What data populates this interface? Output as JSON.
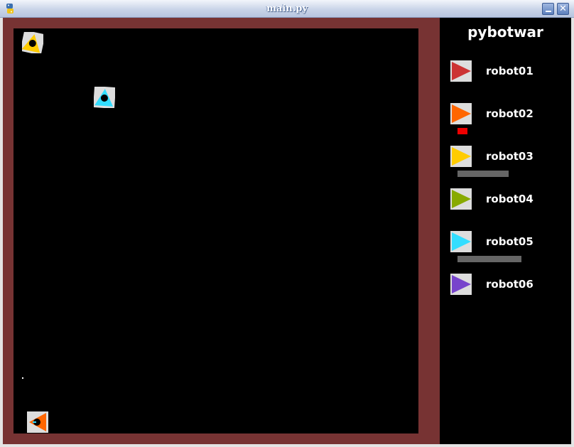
{
  "window": {
    "title": "main.py",
    "minimize_icon": "minimize-icon",
    "close_icon": "close-icon",
    "close_glyph": "✕",
    "app_icon": "python-icon"
  },
  "colors": {
    "arena_border": "#773333",
    "arena_background": "#000000",
    "badge_background": "#dddddd",
    "bar_gray": "#666666",
    "bar_red": "#ee0000"
  },
  "sidebar": {
    "title": "pybotwar",
    "robots": [
      {
        "label": "robot01",
        "color": "#cc3333",
        "health_bar": null
      },
      {
        "label": "robot02",
        "color": "#ff6600",
        "health_bar": {
          "fraction": 0.16,
          "color": "#ee0000"
        }
      },
      {
        "label": "robot03",
        "color": "#ffcc00",
        "health_bar": {
          "fraction": 0.8,
          "color": "#666666"
        }
      },
      {
        "label": "robot04",
        "color": "#88aa00",
        "health_bar": null
      },
      {
        "label": "robot05",
        "color": "#33ddff",
        "health_bar": {
          "fraction": 1.0,
          "color": "#666666"
        }
      },
      {
        "label": "robot06",
        "color": "#7744cc",
        "health_bar": null
      }
    ]
  },
  "arena": {
    "robots": [
      {
        "robot": "robot03",
        "color": "#ffcc00",
        "heading": "up"
      },
      {
        "robot": "robot05",
        "color": "#33ddff",
        "heading": "up"
      },
      {
        "robot": "robot02",
        "color": "#ff6600",
        "heading": "left"
      }
    ]
  }
}
